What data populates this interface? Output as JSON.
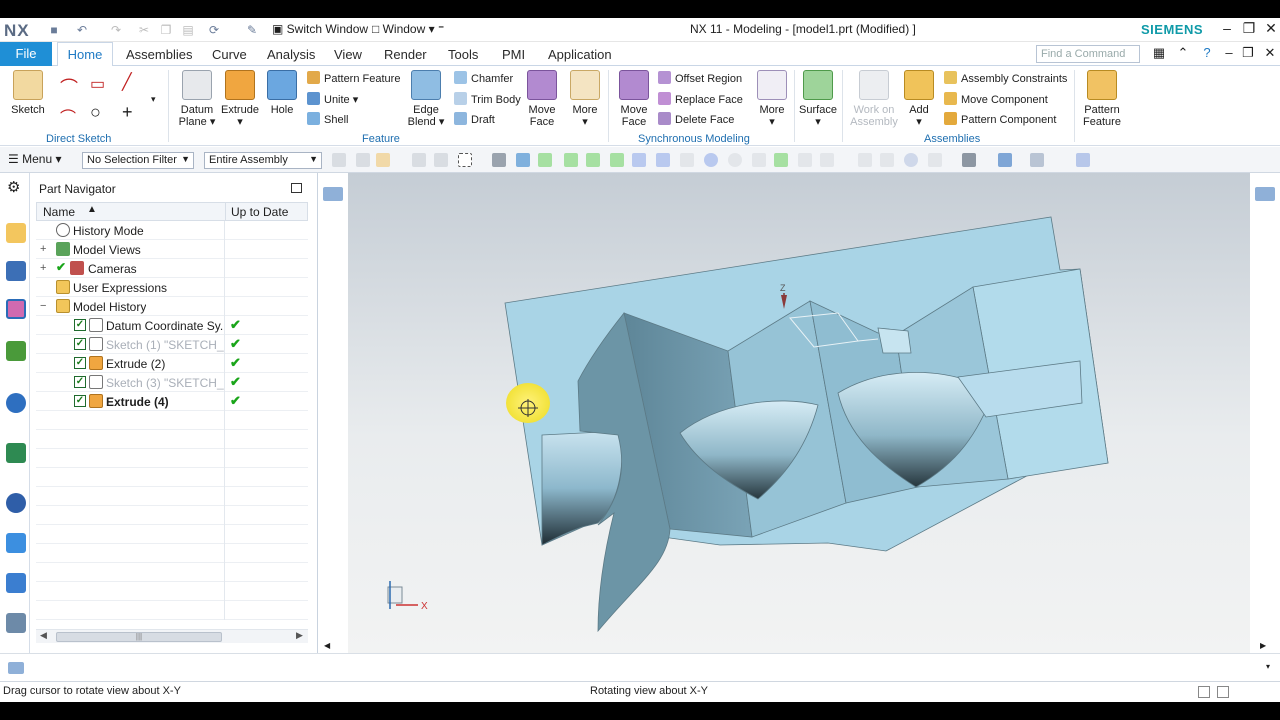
{
  "app": {
    "logo": "NX",
    "window_title": "NX 11 - Modeling - [model1.prt (Modified) ]",
    "brand": "SIEMENS",
    "switch_window": "Switch Window",
    "window_menu": "Window ▾",
    "find_command_placeholder": "Find a Command"
  },
  "menu": {
    "file": "File",
    "tabs": [
      "Home",
      "Assemblies",
      "Curve",
      "Analysis",
      "View",
      "Render",
      "Tools",
      "PMI",
      "Application"
    ]
  },
  "ribbon": {
    "sketch": "Sketch",
    "datum_plane": "Datum\nPlane ▾",
    "extrude": "Extrude\n▾",
    "hole": "Hole",
    "pattern_feature": "Pattern Feature",
    "unite": "Unite ▾",
    "shell": "Shell",
    "edge_blend": "Edge\nBlend ▾",
    "chamfer": "Chamfer",
    "trim_body": "Trim Body",
    "draft": "Draft",
    "move_face_1": "Move\nFace",
    "more_1": "More\n▾",
    "move_face_2": "Move\nFace",
    "offset_region": "Offset Region",
    "replace_face": "Replace Face",
    "delete_face": "Delete Face",
    "more_2": "More\n▾",
    "surface": "Surface\n▾",
    "work_on_assembly": "Work on\nAssembly",
    "add": "Add\n▾",
    "assembly_constraints": "Assembly Constraints",
    "move_component": "Move Component",
    "pattern_component": "Pattern Component",
    "pattern_feature_big": "Pattern\nFeature",
    "groups": {
      "direct_sketch": "Direct Sketch",
      "feature": "Feature",
      "synchronous": "Synchronous Modeling",
      "assemblies": "Assemblies"
    }
  },
  "toolbar": {
    "menu": "Menu ▾",
    "selection_filter": "No Selection Filter",
    "assembly_scope": "Entire Assembly"
  },
  "navigator": {
    "title": "Part Navigator",
    "col_name": "Name",
    "col_uptodate": "Up to Date",
    "rows": [
      {
        "label": "History Mode",
        "icon": "clock-icon",
        "checked": false,
        "uptodate": ""
      },
      {
        "label": "Model Views",
        "icon": "views-icon",
        "checked": false,
        "uptodate": ""
      },
      {
        "label": "Cameras",
        "icon": "camera-icon",
        "checked": false,
        "uptodate": ""
      },
      {
        "label": "User Expressions",
        "icon": "folder-icon",
        "checked": false,
        "uptodate": ""
      },
      {
        "label": "Model History",
        "icon": "folder-icon",
        "checked": false,
        "uptodate": ""
      },
      {
        "label": "Datum Coordinate Sy...",
        "icon": "datum-csys-icon",
        "checked": true,
        "uptodate": "✔"
      },
      {
        "label": "Sketch (1) \"SKETCH_0...",
        "icon": "sketch-icon",
        "checked": true,
        "uptodate": "✔"
      },
      {
        "label": "Extrude (2)",
        "icon": "extrude-icon",
        "checked": true,
        "uptodate": "✔"
      },
      {
        "label": "Sketch (3) \"SKETCH_0...",
        "icon": "sketch-icon",
        "checked": true,
        "uptodate": "✔"
      },
      {
        "label": "Extrude (4)",
        "icon": "extrude-icon",
        "checked": true,
        "uptodate": "✔"
      }
    ]
  },
  "viewport": {
    "triad_x": "X",
    "triad_z": "Z"
  },
  "status": {
    "left": "Drag cursor to rotate view about X-Y",
    "center": "Rotating view about X-Y"
  },
  "colors": {
    "accent": "#1f8fd6",
    "model_face": "#a9d3e6",
    "group_label": "#1f6fb0",
    "brand": "#0f9aa8"
  }
}
